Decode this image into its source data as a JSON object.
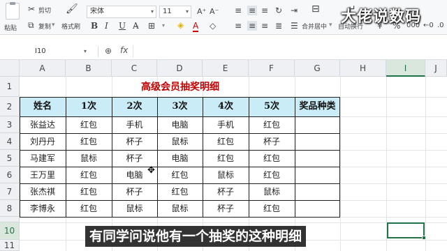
{
  "ribbon": {
    "paste": "粘贴",
    "cut": "剪切",
    "copy": "复制",
    "format_painter": "格式刷",
    "font_name": "宋体",
    "font_size": "11",
    "increase_font": "A⁺",
    "decrease_font": "A⁻",
    "merge_center": "合并居中",
    "wrap_text": "自动换行",
    "currency": "¥",
    "percent": "%"
  },
  "brand": "大佬说数码",
  "formula_bar": {
    "name_box": "I10",
    "fx": "fx",
    "formula": ""
  },
  "columns": [
    "A",
    "B",
    "C",
    "D",
    "E",
    "F",
    "G",
    "H",
    "I",
    "J"
  ],
  "rows": [
    "1",
    "2",
    "3",
    "4",
    "5",
    "6",
    "7",
    "8",
    "9",
    "10",
    "11"
  ],
  "selected_column": "I",
  "selected_row": "10",
  "sheet": {
    "title": "高级会员抽奖明细",
    "headers": [
      "姓名",
      "1次",
      "2次",
      "3次",
      "4次",
      "5次",
      "奖品种类"
    ],
    "data": [
      [
        "张益达",
        "红包",
        "手机",
        "电脑",
        "手机",
        "红包",
        ""
      ],
      [
        "刘丹丹",
        "红包",
        "杯子",
        "鼠标",
        "红包",
        "杯子",
        ""
      ],
      [
        "马建军",
        "鼠标",
        "杯子",
        "电脑",
        "红包",
        "红包",
        ""
      ],
      [
        "王万里",
        "红包",
        "电脑",
        "红包",
        "鼠标",
        "红包",
        ""
      ],
      [
        "张杰祺",
        "红包",
        "杯子",
        "红包",
        "杯子",
        "鼠标",
        ""
      ],
      [
        "李博永",
        "红包",
        "鼠标",
        "鼠标",
        "杯子",
        "红包",
        ""
      ]
    ]
  },
  "subtitle": "有同学问说他有一个抽奖的这种明细",
  "icons": {
    "cut": "scissors-icon",
    "copy": "copy-icon",
    "brush": "brush-icon",
    "zoom": "zoom-icon",
    "cursor": "move-cursor-icon"
  }
}
